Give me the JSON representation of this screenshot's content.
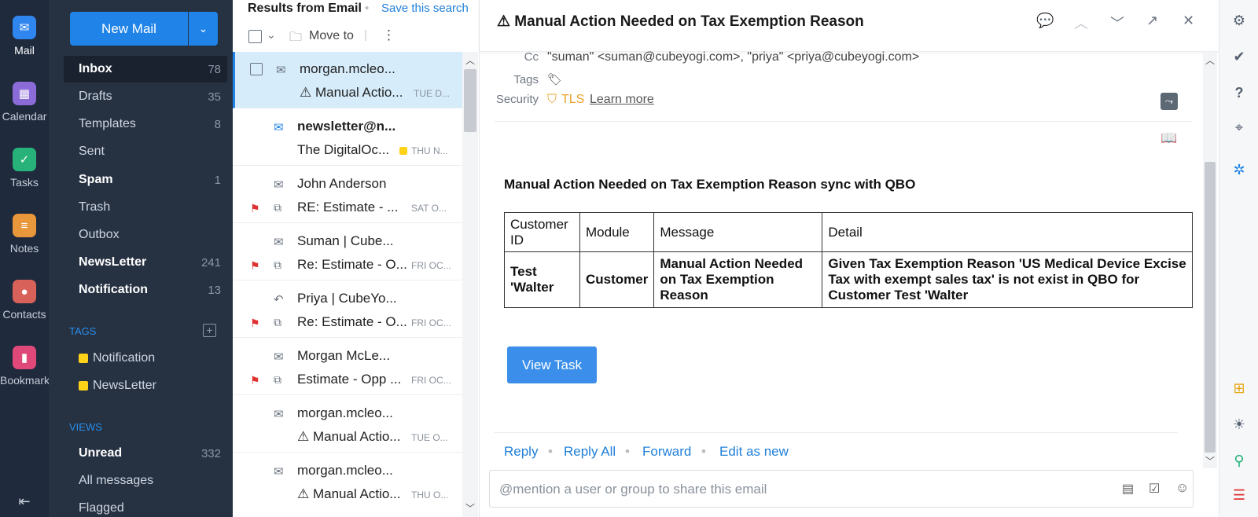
{
  "rail": {
    "items": [
      {
        "label": "Mail",
        "icon": "mail-icon",
        "color": "#2f86ef"
      },
      {
        "label": "Calendar",
        "icon": "calendar-icon",
        "color": "#8b6bd8"
      },
      {
        "label": "Tasks",
        "icon": "tasks-icon",
        "color": "#27b27a"
      },
      {
        "label": "Notes",
        "icon": "notes-icon",
        "color": "#e8973a"
      },
      {
        "label": "Contacts",
        "icon": "contacts-icon",
        "color": "#d8625a"
      },
      {
        "label": "Bookmarks",
        "icon": "bookmarks-icon",
        "color": "#e0487a"
      }
    ]
  },
  "folders": {
    "new_mail": "New Mail",
    "items": [
      {
        "label": "Inbox",
        "count": "78"
      },
      {
        "label": "Drafts",
        "count": "35"
      },
      {
        "label": "Templates",
        "count": "8"
      },
      {
        "label": "Sent",
        "count": ""
      },
      {
        "label": "Spam",
        "count": "1"
      },
      {
        "label": "Trash",
        "count": ""
      },
      {
        "label": "Outbox",
        "count": ""
      },
      {
        "label": "NewsLetter",
        "count": "241"
      },
      {
        "label": "Notification",
        "count": "13"
      }
    ],
    "tags_label": "TAGS",
    "tags": [
      "Notification",
      "NewsLetter"
    ],
    "views_label": "VIEWS",
    "views": [
      {
        "label": "Unread",
        "count": "332"
      },
      {
        "label": "All messages",
        "count": ""
      },
      {
        "label": "Flagged",
        "count": ""
      }
    ]
  },
  "list": {
    "title": "Results from Email",
    "save_search": "Save this search",
    "move_to": "Move to",
    "rows": [
      {
        "from": "morgan.mcleo...",
        "subject": "⚠ Manual Actio...",
        "date": "TUE D..."
      },
      {
        "from": "newsletter@n...",
        "subject": "The DigitalOc...",
        "date": "THU N..."
      },
      {
        "from": "John Anderson",
        "subject": "RE: Estimate - ...",
        "date": "SAT O..."
      },
      {
        "from": "Suman | Cube...",
        "subject": "Re: Estimate - O...",
        "date": "FRI OC..."
      },
      {
        "from": "Priya | CubeYo...",
        "subject": "Re: Estimate - O...",
        "date": "FRI OC..."
      },
      {
        "from": "Morgan McLe...",
        "subject": "Estimate - Opp ...",
        "date": "FRI OC..."
      },
      {
        "from": "morgan.mcleo...",
        "subject": "⚠ Manual Actio...",
        "date": "TUE O..."
      },
      {
        "from": "morgan.mcleo...",
        "subject": "⚠ Manual Actio...",
        "date": "THU O..."
      }
    ]
  },
  "reader": {
    "title": "⚠ Manual Action Needed on Tax Exemption Reason",
    "cc_label": "Cc",
    "cc_value": "\"suman\" <suman@cubeyogi.com>, \"priya\" <priya@cubeyogi.com>",
    "tags_label": "Tags",
    "security_label": "Security",
    "security_value": "TLS",
    "learn_more": "Learn more",
    "body_heading": "Manual Action Needed on Tax Exemption Reason sync with QBO",
    "table": {
      "headers": [
        "Customer ID",
        "Module",
        "Message",
        "Detail"
      ],
      "row": [
        "Test 'Walter",
        "Customer",
        "Manual Action Needed on Tax Exemption Reason",
        "Given Tax Exemption Reason 'US Medical Device Excise Tax with exempt sales tax' is not exist in QBO for Customer Test 'Walter"
      ]
    },
    "view_task": "View Task",
    "actions": [
      "Reply",
      "Reply All",
      "Forward",
      "Edit as new"
    ],
    "reply_placeholder": "@mention a user or group to share this email"
  }
}
